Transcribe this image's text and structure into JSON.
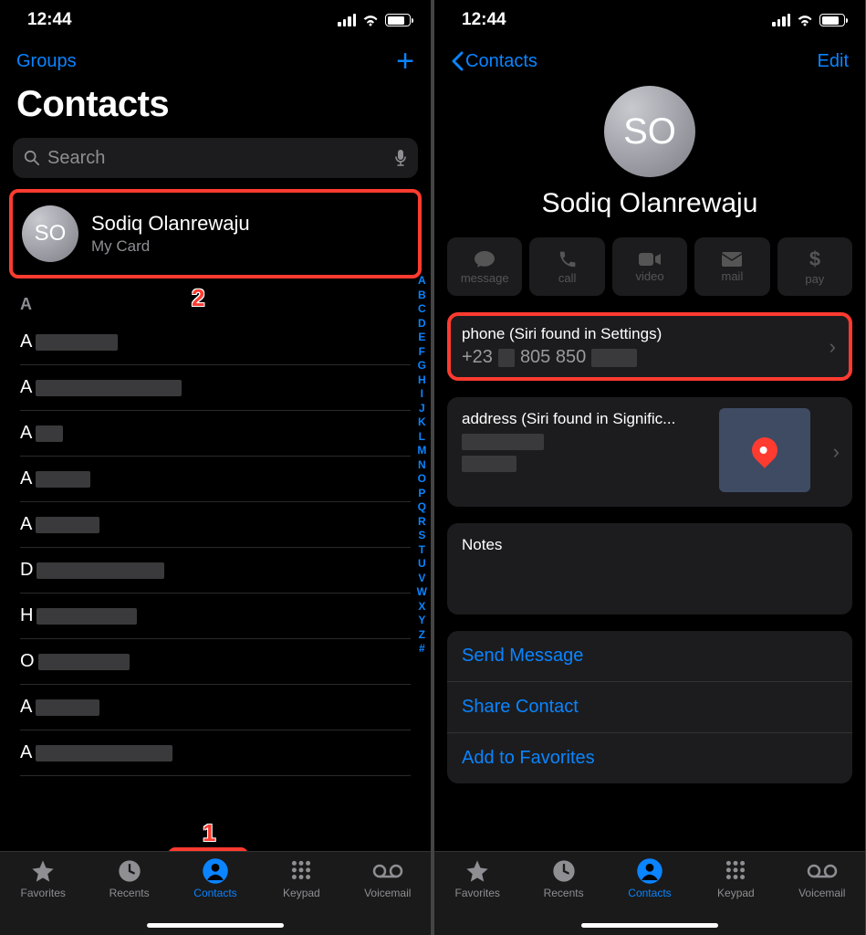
{
  "status": {
    "time": "12:44"
  },
  "left": {
    "groups": "Groups",
    "title": "Contacts",
    "search_placeholder": "Search",
    "mycard": {
      "initials": "SO",
      "name": "Sodiq Olanrewaju",
      "sub": "My Card"
    },
    "section": "A",
    "rows": [
      "A",
      "A",
      "A",
      "A",
      "A",
      "D",
      "H",
      "O",
      "A",
      "A"
    ],
    "index": [
      "A",
      "B",
      "C",
      "D",
      "E",
      "F",
      "G",
      "H",
      "I",
      "J",
      "K",
      "L",
      "M",
      "N",
      "O",
      "P",
      "Q",
      "R",
      "S",
      "T",
      "U",
      "V",
      "W",
      "X",
      "Y",
      "Z",
      "#"
    ],
    "callout1": "1",
    "callout2": "2"
  },
  "right": {
    "back": "Contacts",
    "edit": "Edit",
    "avatar_initials": "SO",
    "name": "Sodiq Olanrewaju",
    "actions": {
      "message": "message",
      "call": "call",
      "video": "video",
      "mail": "mail",
      "pay": "pay"
    },
    "phone": {
      "label": "phone (Siri found in Settings)",
      "value_prefix": "+23",
      "value_mid": "805 850"
    },
    "address": {
      "label": "address (Siri found in Signific..."
    },
    "notes_label": "Notes",
    "links": {
      "send": "Send Message",
      "share": "Share Contact",
      "fav": "Add to Favorites"
    }
  },
  "tabs": {
    "favorites": "Favorites",
    "recents": "Recents",
    "contacts": "Contacts",
    "keypad": "Keypad",
    "voicemail": "Voicemail"
  }
}
